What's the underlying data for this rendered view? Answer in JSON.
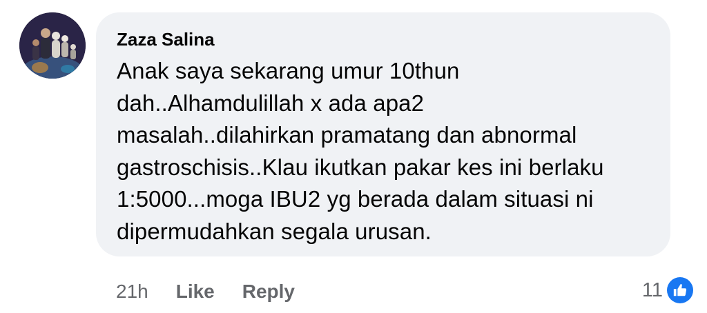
{
  "comment": {
    "author": "Zaza Salina",
    "text": "Anak saya sekarang umur 10thun\ndah..Alhamdulillah x ada apa2\nmasalah..dilahirkan pramatang dan abnormal\ngastroschisis..Klau ikutkan pakar kes ini berlaku\n1:5000...moga IBU2 yg berada dalam situasi ni\ndipermudahkan segala urusan.",
    "timestamp": "21h",
    "like_label": "Like",
    "reply_label": "Reply",
    "reaction_count": "11",
    "reaction_icon": "thumbs-up-icon"
  },
  "colors": {
    "bubble_bg": "#f0f2f5",
    "text": "#050505",
    "secondary": "#65676b",
    "like_blue": "#1877f2"
  }
}
